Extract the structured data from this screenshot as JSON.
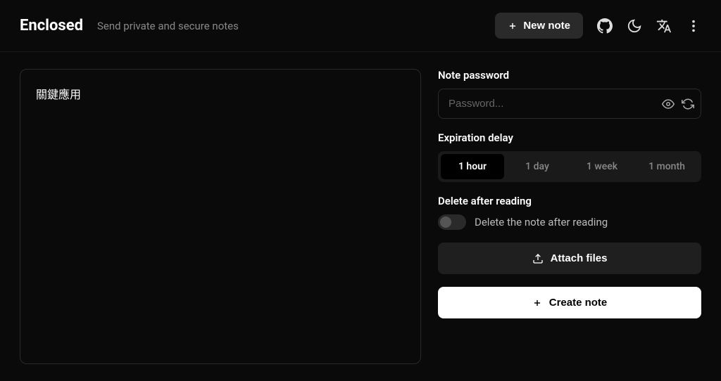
{
  "header": {
    "logo": "Enclosed",
    "tagline": "Send private and secure notes",
    "new_note_label": "New note"
  },
  "editor": {
    "content": "關鍵應用"
  },
  "sidebar": {
    "password": {
      "label": "Note password",
      "placeholder": "Password..."
    },
    "expiration": {
      "label": "Expiration delay",
      "options": [
        "1 hour",
        "1 day",
        "1 week",
        "1 month"
      ],
      "selected": 0
    },
    "delete_after_reading": {
      "label": "Delete after reading",
      "toggle_label": "Delete the note after reading",
      "enabled": false
    },
    "attach_label": "Attach files",
    "create_label": "Create note"
  }
}
